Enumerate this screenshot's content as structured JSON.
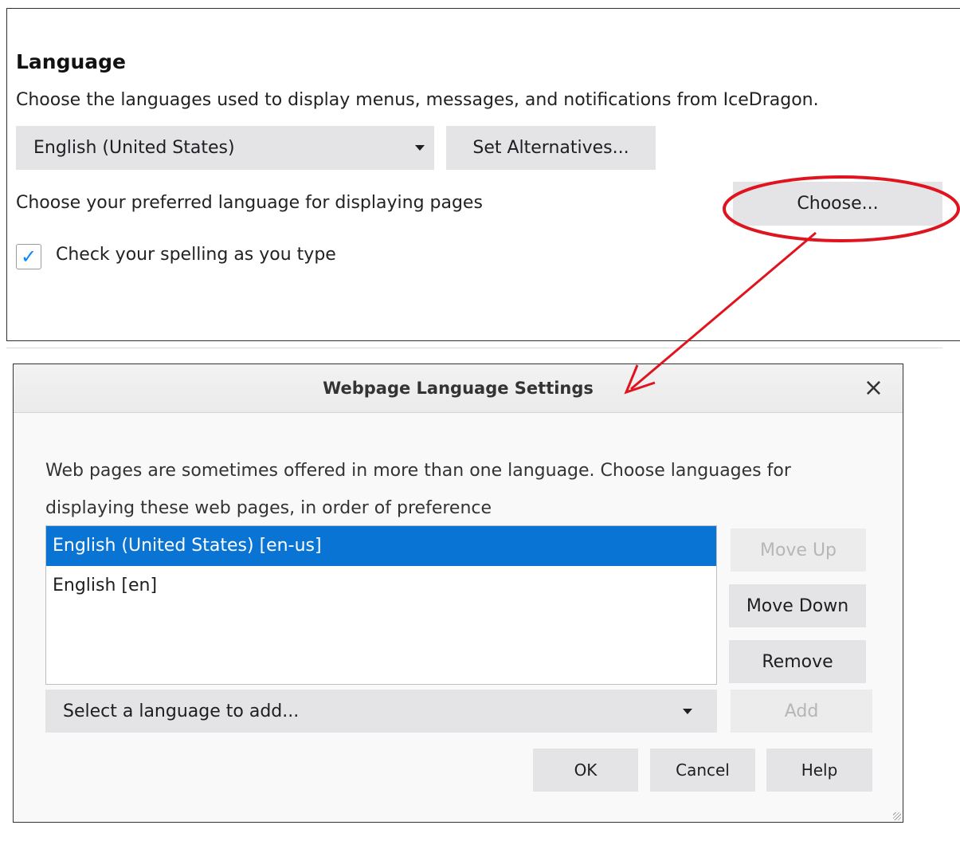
{
  "language_section": {
    "title": "Language",
    "description": "Choose the languages used to display menus, messages, and notifications from IceDragon.",
    "language_dropdown_value": "English (United States)",
    "set_alternatives_label": "Set Alternatives...",
    "preferred_language_text": "Choose your preferred language for displaying pages",
    "choose_label": "Choose...",
    "spellcheck_label": "Check your spelling as you type",
    "spellcheck_checked": true
  },
  "dialog": {
    "title": "Webpage Language Settings",
    "close_glyph": "×",
    "description": "Web pages are sometimes offered in more than one language. Choose languages for displaying these web pages, in order of preference",
    "languages": [
      {
        "label": "English (United States) [en-us]",
        "selected": true
      },
      {
        "label": "English [en]",
        "selected": false
      }
    ],
    "move_up_label": "Move Up",
    "move_down_label": "Move Down",
    "remove_label": "Remove",
    "add_select_placeholder": "Select a language to add...",
    "add_label": "Add",
    "ok_label": "OK",
    "cancel_label": "Cancel",
    "help_label": "Help"
  },
  "colors": {
    "selection": "#0a74d4",
    "checkbox_check": "#0a84ff",
    "annotation": "#e0141e"
  },
  "icons": {
    "dropdown": "chevron-down-icon",
    "checkbox": "checkmark-icon",
    "close": "close-icon"
  }
}
